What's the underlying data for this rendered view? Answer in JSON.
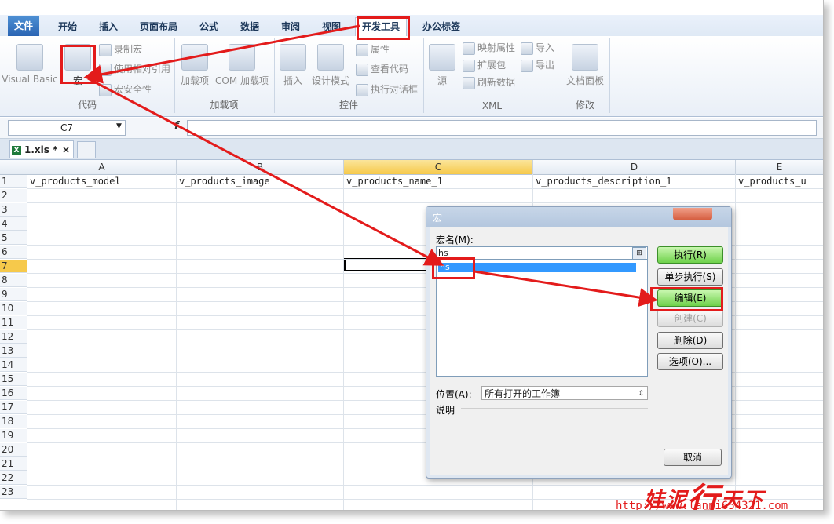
{
  "ribbon_tabs": [
    "文件",
    "开始",
    "插入",
    "页面布局",
    "公式",
    "数据",
    "审阅",
    "视图",
    "开发工具",
    "办公标签"
  ],
  "ribbon": {
    "code": {
      "label": "代码",
      "visual_basic": "Visual Basic",
      "macros": "宏",
      "record": "录制宏",
      "relative": "使用相对引用",
      "security": "宏安全性"
    },
    "addins": {
      "label": "加载项",
      "addins": "加载项",
      "com": "COM 加载项"
    },
    "controls": {
      "label": "控件",
      "insert": "插入",
      "design": "设计模式",
      "properties": "属性",
      "view_code": "查看代码",
      "run_dialog": "执行对话框"
    },
    "xml": {
      "label": "XML",
      "source": "源",
      "map_props": "映射属性",
      "expansion": "扩展包",
      "refresh": "刷新数据",
      "import": "导入",
      "export": "导出"
    },
    "modify": {
      "label": "修改",
      "doc_panel": "文档面板"
    }
  },
  "formula_bar": {
    "name_box": "C7",
    "fx": "f"
  },
  "workbook_tab": {
    "name": "1.xls *",
    "close": "×"
  },
  "columns": [
    "A",
    "B",
    "C",
    "D",
    "E"
  ],
  "row1": [
    "v_products_model",
    "v_products_image",
    "v_products_name_1",
    "v_products_description_1",
    "v_products_u"
  ],
  "rows": [
    "1",
    "2",
    "3",
    "4",
    "5",
    "6",
    "7",
    "8",
    "9",
    "10",
    "11",
    "12",
    "13",
    "14",
    "15",
    "16",
    "17",
    "18",
    "19",
    "20",
    "21",
    "22",
    "23"
  ],
  "dialog": {
    "title": "宏",
    "macro_name_label": "宏名(M):",
    "macro_name_value": "hs",
    "list_item": "hs",
    "buttons": {
      "run": "执行(R)",
      "step": "单步执行(S)",
      "edit": "编辑(E)",
      "create": "创建(C)",
      "delete": "删除(D)",
      "options": "选项(O)...",
      "cancel": "取消"
    },
    "location_label": "位置(A):",
    "location_value": "所有打开的工作簿",
    "description_label": "说明"
  },
  "watermark": {
    "text_a": "娃泥",
    "text_big": "行",
    "text_b": "天下",
    "url": "http://www.lanni654321.com"
  },
  "annotation_color": "#e31b1b"
}
